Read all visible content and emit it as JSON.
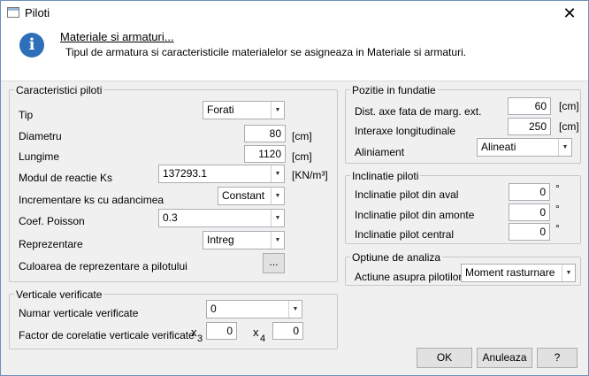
{
  "window": {
    "title": "Piloti"
  },
  "info": {
    "title": "Materiale si armaturi...",
    "text": "Tipul de armatura si caracteristicile materialelor se asigneaza in Materiale si armaturi."
  },
  "caracteristici": {
    "legend": "Caracteristici piloti",
    "tip_label": "Tip",
    "tip_value": "Forati",
    "diametru_label": "Diametru",
    "diametru_value": "80",
    "diametru_unit": "[cm]",
    "lungime_label": "Lungime",
    "lungime_value": "1120",
    "lungime_unit": "[cm]",
    "modul_label": "Modul de reactie Ks",
    "modul_value": "137293.1",
    "modul_unit": "[KN/m³]",
    "incrementare_label": "Incrementare ks cu adancimea",
    "incrementare_value": "Constant",
    "poisson_label": "Coef. Poisson",
    "poisson_value": "0.3",
    "reprezentare_label": "Reprezentare",
    "reprezentare_value": "Intreg",
    "culoare_label": "Culoarea de reprezentare a pilotului",
    "culoare_button": "..."
  },
  "verticale": {
    "legend": "Verticale verificate",
    "numar_label": "Numar verticale verificate",
    "numar_value": "0",
    "factor_label": "Factor de corelatie verticale verificate",
    "x3_label": "x",
    "x3_sub": "3",
    "x3_value": "0",
    "x4_label": "x",
    "x4_sub": "4",
    "x4_value": "0"
  },
  "pozitie": {
    "legend": "Pozitie in fundatie",
    "dist_label": "Dist. axe fata de marg. ext.",
    "dist_value": "60",
    "dist_unit": "[cm]",
    "interaxe_label": "Interaxe longitudinale",
    "interaxe_value": "250",
    "interaxe_unit": "[cm]",
    "aliniament_label": "Aliniament",
    "aliniament_value": "Alineati"
  },
  "inclinatie": {
    "legend": "Inclinatie piloti",
    "aval_label": "Inclinatie pilot din aval",
    "aval_value": "0",
    "aval_unit": "°",
    "amonte_label": "Inclinatie pilot din amonte",
    "amonte_value": "0",
    "amonte_unit": "°",
    "central_label": "Inclinatie pilot central",
    "central_value": "0",
    "central_unit": "°"
  },
  "optiune": {
    "legend": "Optiune de analiza",
    "actiune_label": "Actiune asupra pilotilor",
    "actiune_value": "Moment rasturnare"
  },
  "buttons": {
    "ok": "OK",
    "cancel": "Anuleaza",
    "help": "?"
  },
  "icons": {
    "app": "window-icon",
    "info": "info-icon",
    "close": "close-icon",
    "dropdown": "chevron-down-icon"
  }
}
